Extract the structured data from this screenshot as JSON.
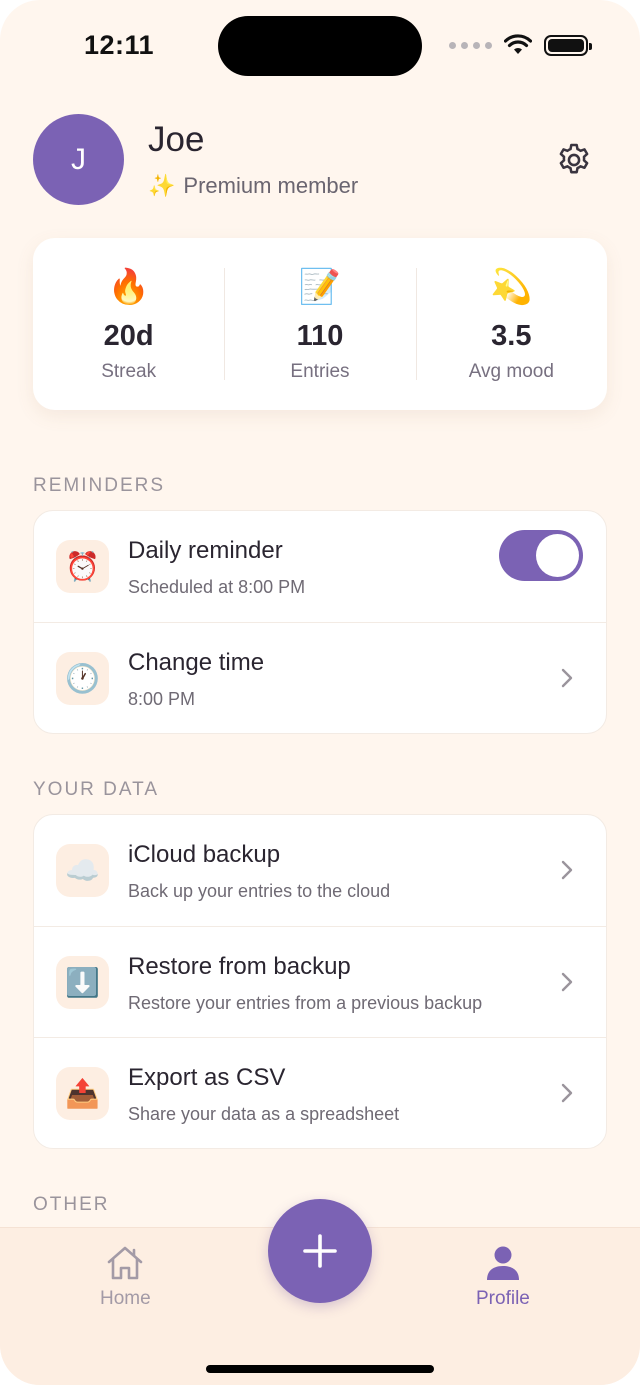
{
  "status_bar": {
    "time": "12:11"
  },
  "profile": {
    "avatar_initial": "J",
    "name": "Joe",
    "membership_emoji": "✨",
    "membership": "Premium member"
  },
  "stats": [
    {
      "emoji": "🔥",
      "value": "20d",
      "label": "Streak"
    },
    {
      "emoji": "📝",
      "value": "110",
      "label": "Entries"
    },
    {
      "emoji": "💫",
      "value": "3.5",
      "label": "Avg mood"
    }
  ],
  "reminders": {
    "section_title": "REMINDERS",
    "daily": {
      "emoji": "⏰",
      "title": "Daily reminder",
      "subtitle": "Scheduled at 8:00 PM",
      "enabled": true
    },
    "change_time": {
      "emoji": "🕐",
      "title": "Change time",
      "subtitle": "8:00 PM"
    }
  },
  "your_data": {
    "section_title": "YOUR DATA",
    "items": [
      {
        "emoji": "☁️",
        "title": "iCloud backup",
        "subtitle": "Back up your entries to the cloud"
      },
      {
        "emoji": "⬇️",
        "title": "Restore from backup",
        "subtitle": "Restore your entries from a previous backup"
      },
      {
        "emoji": "📤",
        "title": "Export as CSV",
        "subtitle": "Share your data as a spreadsheet"
      }
    ]
  },
  "other": {
    "section_title": "OTHER"
  },
  "tab_bar": {
    "home_label": "Home",
    "profile_label": "Profile",
    "active_tab": "Profile"
  },
  "colors": {
    "accent": "#7b62b4",
    "background": "#fff6ee",
    "tab_bar": "#fdeee2",
    "icon_tile": "#fdeee2"
  }
}
